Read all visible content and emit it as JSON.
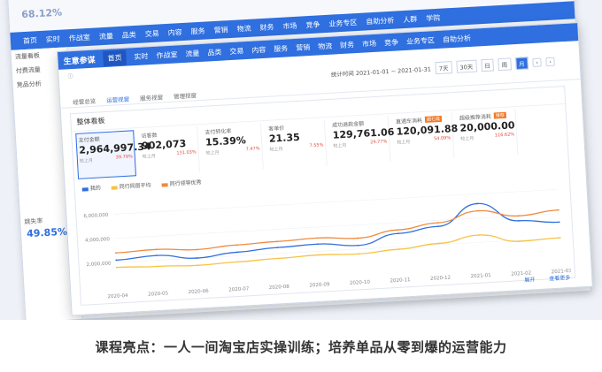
{
  "back": {
    "top_pct": "68.12%",
    "nav": [
      "首页",
      "实时",
      "作战室",
      "流量",
      "品类",
      "交易",
      "内容",
      "服务",
      "营销",
      "物流",
      "财务",
      "市场",
      "竞争",
      "业务专区",
      "自助分析",
      "人群",
      "学院"
    ],
    "side": [
      "流量看板",
      "付费流量",
      "竞品分析"
    ],
    "stat_label": "跳失率",
    "stat_value": "49.85%"
  },
  "front": {
    "brand": "生意参谋",
    "nav": [
      "首页",
      "实时",
      "作战室",
      "流量",
      "品类",
      "交易",
      "内容",
      "服务",
      "营销",
      "物流",
      "财务",
      "市场",
      "竞争",
      "业务专区",
      "自助分析"
    ],
    "active_nav": 0,
    "date_range": "统计时间 2021-01-01 ~ 2021-01-31",
    "date_segments": [
      "7天",
      "30天",
      "日",
      "周",
      "月"
    ],
    "active_segment": 4,
    "tabs": [
      "经营总览",
      "运营视窗",
      "服务视窗",
      "管理视窗"
    ],
    "active_tab": 1,
    "panel_title": "整体看板",
    "kpis": [
      {
        "label": "支付金额",
        "value": "2,964,997.34",
        "sub": "较上月",
        "rate": "39.79%"
      },
      {
        "label": "访客数",
        "value": "902,073",
        "sub": "较上月",
        "rate": "131.03%"
      },
      {
        "label": "支付转化率",
        "value": "15.39%",
        "sub": "较上月",
        "rate": "7.47%"
      },
      {
        "label": "客单价",
        "value": "21.35",
        "sub": "较上月",
        "rate": "7.55%"
      },
      {
        "label": "成功退款金额",
        "value": "129,761.06",
        "sub": "较上月",
        "rate": "29.77%"
      },
      {
        "label": "直通车消耗",
        "value": "120,091.88",
        "sub": "较上月",
        "rate": "54.09%",
        "badge": "超七成"
      },
      {
        "label": "超级推荐消耗",
        "value": "20,000.00",
        "sub": "较上月",
        "rate": "116.62%",
        "badge": "推荐"
      }
    ],
    "legend": [
      "我的",
      "同行同层平均",
      "同行领导优秀"
    ],
    "footer_left": "展开",
    "footer_right": "查看更多"
  },
  "chart_data": {
    "type": "line",
    "x": [
      "2020-04",
      "2020-05",
      "2020-06",
      "2020-07",
      "2020-08",
      "2020-09",
      "2020-10",
      "2020-11",
      "2020-12",
      "2021-01",
      "2021-02",
      "2021-03"
    ],
    "yticks": [
      "6,000,000",
      "4,000,000",
      "2,000,000"
    ],
    "ylim": [
      0,
      7000000
    ],
    "series": [
      {
        "name": "我的",
        "color": "#2f6fdf",
        "values": [
          2200000,
          2400000,
          2000000,
          2300000,
          2500000,
          2600000,
          2300000,
          3100000,
          3500000,
          5200000,
          3600000,
          3300000
        ]
      },
      {
        "name": "同行同层平均",
        "color": "#f6c343",
        "values": [
          1600000,
          1500000,
          1400000,
          1500000,
          1600000,
          1700000,
          1600000,
          1800000,
          2100000,
          2600000,
          1900000,
          2000000
        ]
      },
      {
        "name": "同行领导优秀",
        "color": "#f08a3c",
        "values": [
          2800000,
          2900000,
          2700000,
          2900000,
          3000000,
          3100000,
          2900000,
          3400000,
          3800000,
          4600000,
          4000000,
          4300000
        ]
      }
    ]
  },
  "caption": "课程亮点：一人一间淘宝店实操训练；培养单品从零到爆的运营能力",
  "colors": {
    "accent": "#2f6fdf",
    "bar": "#f07a2a"
  }
}
